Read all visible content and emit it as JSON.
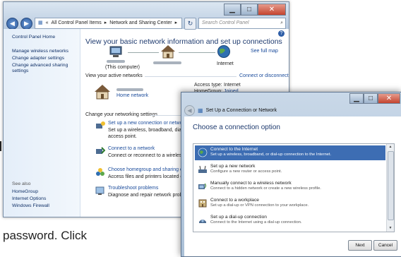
{
  "window": {
    "address_parts": [
      "«",
      "All Control Panel Items",
      "▸",
      "Network and Sharing Center",
      "▸"
    ],
    "search_placeholder": "Search Control Panel",
    "left_pane": {
      "home": "Control Panel Home",
      "links": [
        "Manage wireless networks",
        "Change adapter settings",
        "Change advanced sharing",
        "settings"
      ],
      "see_also_title": "See also",
      "see_also": [
        "HomeGroup",
        "Internet Options",
        "Windows Firewall"
      ]
    },
    "main": {
      "heading": "View your basic network information and set up connections",
      "see_full_map": "See full map",
      "this_computer": "(This computer)",
      "internet": "Internet",
      "active_networks_title": "View your active networks",
      "connect_disconnect": "Connect or disconnect",
      "home_network": "Home network",
      "access_type_label": "Access type:",
      "access_type_value": "Internet",
      "homegroup_label": "HomeGroup:",
      "homegroup_value": "Joined",
      "change_settings_title": "Change your networking settings",
      "tasks": [
        {
          "link": "Set up a new connection or network",
          "desc1": "Set up a wireless, broadband, dial-up, a",
          "desc2": "access point."
        },
        {
          "link": "Connect to a network",
          "desc1": "Connect or reconnect to a wireless, wir",
          "desc2": ""
        },
        {
          "link": "Choose homegroup and sharing option",
          "desc1": "Access files and printers located on othe",
          "desc2": ""
        },
        {
          "link": "Troubleshoot problems",
          "desc1": "Diagnose and repair network problems, o",
          "desc2": ""
        }
      ]
    }
  },
  "dialog": {
    "title": "Set Up a Connection or Network",
    "heading": "Choose a connection option",
    "options": [
      {
        "title": "Connect to the Internet",
        "desc": "Set up a wireless, broadband, or dial-up connection to the Internet.",
        "selected": true
      },
      {
        "title": "Set up a new network",
        "desc": "Configure a new router or access point.",
        "selected": false
      },
      {
        "title": "Manually connect to a wireless network",
        "desc": "Connect to a hidden network or create a new wireless profile.",
        "selected": false
      },
      {
        "title": "Connect to a workplace",
        "desc": "Set up a dial-up or VPN connection to your workplace.",
        "selected": false
      },
      {
        "title": "Set up a dial-up connection",
        "desc": "Connect to the Internet using a dial-up connection.",
        "selected": false
      }
    ],
    "next": "Next",
    "cancel": "Cancel"
  },
  "page": {
    "line1": "password. Click"
  }
}
